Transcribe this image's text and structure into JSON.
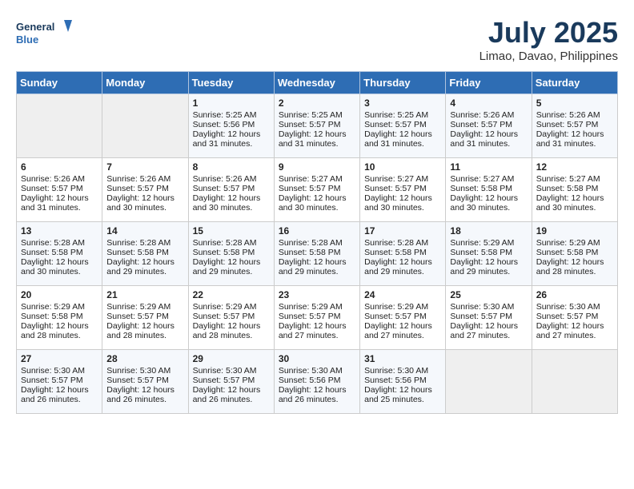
{
  "header": {
    "logo_line1": "General",
    "logo_line2": "Blue",
    "month_year": "July 2025",
    "location": "Limao, Davao, Philippines"
  },
  "days_of_week": [
    "Sunday",
    "Monday",
    "Tuesday",
    "Wednesday",
    "Thursday",
    "Friday",
    "Saturday"
  ],
  "weeks": [
    [
      {
        "day": "",
        "sunrise": "",
        "sunset": "",
        "daylight": "",
        "empty": true
      },
      {
        "day": "",
        "sunrise": "",
        "sunset": "",
        "daylight": "",
        "empty": true
      },
      {
        "day": "1",
        "sunrise": "Sunrise: 5:25 AM",
        "sunset": "Sunset: 5:56 PM",
        "daylight": "Daylight: 12 hours and 31 minutes.",
        "empty": false
      },
      {
        "day": "2",
        "sunrise": "Sunrise: 5:25 AM",
        "sunset": "Sunset: 5:57 PM",
        "daylight": "Daylight: 12 hours and 31 minutes.",
        "empty": false
      },
      {
        "day": "3",
        "sunrise": "Sunrise: 5:25 AM",
        "sunset": "Sunset: 5:57 PM",
        "daylight": "Daylight: 12 hours and 31 minutes.",
        "empty": false
      },
      {
        "day": "4",
        "sunrise": "Sunrise: 5:26 AM",
        "sunset": "Sunset: 5:57 PM",
        "daylight": "Daylight: 12 hours and 31 minutes.",
        "empty": false
      },
      {
        "day": "5",
        "sunrise": "Sunrise: 5:26 AM",
        "sunset": "Sunset: 5:57 PM",
        "daylight": "Daylight: 12 hours and 31 minutes.",
        "empty": false
      }
    ],
    [
      {
        "day": "6",
        "sunrise": "Sunrise: 5:26 AM",
        "sunset": "Sunset: 5:57 PM",
        "daylight": "Daylight: 12 hours and 31 minutes.",
        "empty": false
      },
      {
        "day": "7",
        "sunrise": "Sunrise: 5:26 AM",
        "sunset": "Sunset: 5:57 PM",
        "daylight": "Daylight: 12 hours and 30 minutes.",
        "empty": false
      },
      {
        "day": "8",
        "sunrise": "Sunrise: 5:26 AM",
        "sunset": "Sunset: 5:57 PM",
        "daylight": "Daylight: 12 hours and 30 minutes.",
        "empty": false
      },
      {
        "day": "9",
        "sunrise": "Sunrise: 5:27 AM",
        "sunset": "Sunset: 5:57 PM",
        "daylight": "Daylight: 12 hours and 30 minutes.",
        "empty": false
      },
      {
        "day": "10",
        "sunrise": "Sunrise: 5:27 AM",
        "sunset": "Sunset: 5:57 PM",
        "daylight": "Daylight: 12 hours and 30 minutes.",
        "empty": false
      },
      {
        "day": "11",
        "sunrise": "Sunrise: 5:27 AM",
        "sunset": "Sunset: 5:58 PM",
        "daylight": "Daylight: 12 hours and 30 minutes.",
        "empty": false
      },
      {
        "day": "12",
        "sunrise": "Sunrise: 5:27 AM",
        "sunset": "Sunset: 5:58 PM",
        "daylight": "Daylight: 12 hours and 30 minutes.",
        "empty": false
      }
    ],
    [
      {
        "day": "13",
        "sunrise": "Sunrise: 5:28 AM",
        "sunset": "Sunset: 5:58 PM",
        "daylight": "Daylight: 12 hours and 30 minutes.",
        "empty": false
      },
      {
        "day": "14",
        "sunrise": "Sunrise: 5:28 AM",
        "sunset": "Sunset: 5:58 PM",
        "daylight": "Daylight: 12 hours and 29 minutes.",
        "empty": false
      },
      {
        "day": "15",
        "sunrise": "Sunrise: 5:28 AM",
        "sunset": "Sunset: 5:58 PM",
        "daylight": "Daylight: 12 hours and 29 minutes.",
        "empty": false
      },
      {
        "day": "16",
        "sunrise": "Sunrise: 5:28 AM",
        "sunset": "Sunset: 5:58 PM",
        "daylight": "Daylight: 12 hours and 29 minutes.",
        "empty": false
      },
      {
        "day": "17",
        "sunrise": "Sunrise: 5:28 AM",
        "sunset": "Sunset: 5:58 PM",
        "daylight": "Daylight: 12 hours and 29 minutes.",
        "empty": false
      },
      {
        "day": "18",
        "sunrise": "Sunrise: 5:29 AM",
        "sunset": "Sunset: 5:58 PM",
        "daylight": "Daylight: 12 hours and 29 minutes.",
        "empty": false
      },
      {
        "day": "19",
        "sunrise": "Sunrise: 5:29 AM",
        "sunset": "Sunset: 5:58 PM",
        "daylight": "Daylight: 12 hours and 28 minutes.",
        "empty": false
      }
    ],
    [
      {
        "day": "20",
        "sunrise": "Sunrise: 5:29 AM",
        "sunset": "Sunset: 5:58 PM",
        "daylight": "Daylight: 12 hours and 28 minutes.",
        "empty": false
      },
      {
        "day": "21",
        "sunrise": "Sunrise: 5:29 AM",
        "sunset": "Sunset: 5:57 PM",
        "daylight": "Daylight: 12 hours and 28 minutes.",
        "empty": false
      },
      {
        "day": "22",
        "sunrise": "Sunrise: 5:29 AM",
        "sunset": "Sunset: 5:57 PM",
        "daylight": "Daylight: 12 hours and 28 minutes.",
        "empty": false
      },
      {
        "day": "23",
        "sunrise": "Sunrise: 5:29 AM",
        "sunset": "Sunset: 5:57 PM",
        "daylight": "Daylight: 12 hours and 27 minutes.",
        "empty": false
      },
      {
        "day": "24",
        "sunrise": "Sunrise: 5:29 AM",
        "sunset": "Sunset: 5:57 PM",
        "daylight": "Daylight: 12 hours and 27 minutes.",
        "empty": false
      },
      {
        "day": "25",
        "sunrise": "Sunrise: 5:30 AM",
        "sunset": "Sunset: 5:57 PM",
        "daylight": "Daylight: 12 hours and 27 minutes.",
        "empty": false
      },
      {
        "day": "26",
        "sunrise": "Sunrise: 5:30 AM",
        "sunset": "Sunset: 5:57 PM",
        "daylight": "Daylight: 12 hours and 27 minutes.",
        "empty": false
      }
    ],
    [
      {
        "day": "27",
        "sunrise": "Sunrise: 5:30 AM",
        "sunset": "Sunset: 5:57 PM",
        "daylight": "Daylight: 12 hours and 26 minutes.",
        "empty": false
      },
      {
        "day": "28",
        "sunrise": "Sunrise: 5:30 AM",
        "sunset": "Sunset: 5:57 PM",
        "daylight": "Daylight: 12 hours and 26 minutes.",
        "empty": false
      },
      {
        "day": "29",
        "sunrise": "Sunrise: 5:30 AM",
        "sunset": "Sunset: 5:57 PM",
        "daylight": "Daylight: 12 hours and 26 minutes.",
        "empty": false
      },
      {
        "day": "30",
        "sunrise": "Sunrise: 5:30 AM",
        "sunset": "Sunset: 5:56 PM",
        "daylight": "Daylight: 12 hours and 26 minutes.",
        "empty": false
      },
      {
        "day": "31",
        "sunrise": "Sunrise: 5:30 AM",
        "sunset": "Sunset: 5:56 PM",
        "daylight": "Daylight: 12 hours and 25 minutes.",
        "empty": false
      },
      {
        "day": "",
        "sunrise": "",
        "sunset": "",
        "daylight": "",
        "empty": true
      },
      {
        "day": "",
        "sunrise": "",
        "sunset": "",
        "daylight": "",
        "empty": true
      }
    ]
  ]
}
